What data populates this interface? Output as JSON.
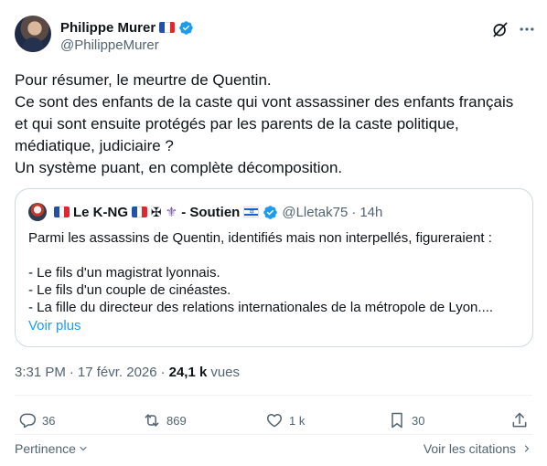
{
  "author": {
    "display_name": "Philippe Murer",
    "handle": "@PhilippeMurer",
    "flag": "🇫🇷",
    "verified": true
  },
  "header_icons": [
    "grok-icon",
    "more-icon"
  ],
  "tweet_text": [
    "Pour résumer, le meurtre de Quentin.",
    "Ce sont des enfants de la caste qui vont assassiner des enfants français",
    "et qui sont ensuite protégés par les parents de la caste politique,",
    "médiatique, judiciaire ?",
    "Un système puant, en complète décomposition."
  ],
  "quote": {
    "display_name": "Le K-NG",
    "suffix": "- Soutien",
    "handle": "@Lletak75",
    "dot": "·",
    "time": "14h",
    "text": [
      "Parmi les assassins de Quentin, identifiés mais non interpellés, figureraient :",
      "",
      "- Le fils d'un magistrat lyonnais.",
      "- Le fils d'un couple de cinéastes.",
      "- La fille du directeur des relations internationales de la métropole de Lyon...."
    ],
    "more_label": "Voir plus"
  },
  "meta": {
    "time": "3:31 PM",
    "dot1": "·",
    "date": "17 févr. 2026",
    "dot2": "·",
    "views_count": "24,1 k",
    "views_label": "vues"
  },
  "actions": {
    "replies": "36",
    "reposts": "869",
    "likes": "1 k",
    "bookmarks": "30"
  },
  "footer": {
    "relevance_label": "Pertinence",
    "quotes_label": "Voir les citations"
  },
  "colors": {
    "text": "#0f1419",
    "secondary": "#536471",
    "link": "#1d9bf0",
    "border": "#cfd9de",
    "divider": "#eff3f4"
  }
}
